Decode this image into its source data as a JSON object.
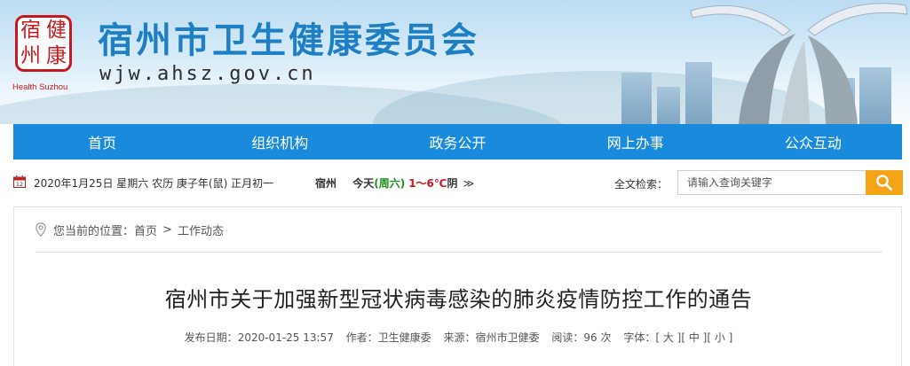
{
  "header": {
    "seal_chars": [
      "宿",
      "健",
      "州",
      "康"
    ],
    "logo_en": "Health Suzhou",
    "title": "宿州市卫生健康委员会",
    "url": "wjw.ahsz.gov.cn"
  },
  "nav": {
    "items": [
      "首页",
      "组织机构",
      "政务公开",
      "网上办事",
      "公众互动"
    ]
  },
  "infobar": {
    "date": "2020年1月25日 星期六 农历 庚子年(鼠) 正月初一",
    "weather_city": "宿州",
    "weather_today": "今天",
    "weather_day": "(周六)",
    "weather_temp": "1～6℃",
    "weather_cond": "阴",
    "weather_more": "≫",
    "search_label": "全文检索：",
    "search_placeholder": "请输入查询关键字"
  },
  "breadcrumb": {
    "prefix": "您当前的位置：",
    "items": [
      "首页",
      "工作动态"
    ],
    "separator": ">"
  },
  "article": {
    "title": "宿州市关于加强新型冠状病毒感染的肺炎疫情防控工作的通告",
    "published_label": "发布日期：",
    "published": "2020-01-25 13:57",
    "author_label": "作者：",
    "author": "卫生健康委",
    "source_label": "来源：",
    "source": "宿州市卫健委",
    "views_label": "阅读：",
    "views": "96 次",
    "font_label": "字体：",
    "font_sizes": [
      "[ 大 ]",
      "[ 中 ]",
      "[ 小 ]"
    ]
  },
  "colors": {
    "nav_bg": "#1a8bdc",
    "title_blue": "#1e7fc4",
    "seal_red": "#c8191f",
    "search_button": "#f5a417"
  },
  "icons": [
    "calendar-icon",
    "arrows-icon",
    "search-icon",
    "location-pin-icon"
  ]
}
